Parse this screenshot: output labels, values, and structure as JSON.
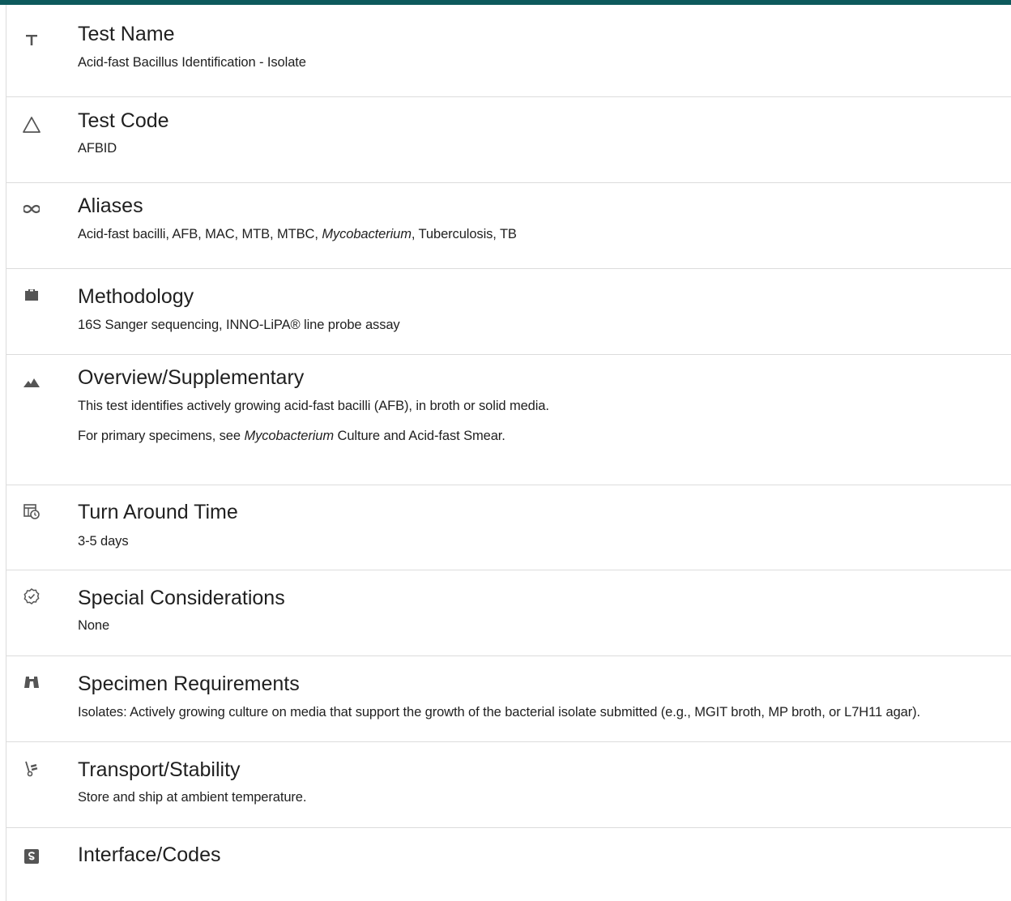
{
  "rows": [
    {
      "title": "Test Name",
      "icon": "text-t-icon",
      "lines": [
        "Acid-fast Bacillus Identification - Isolate"
      ]
    },
    {
      "title": "Test Code",
      "icon": "triangle-icon",
      "lines": [
        "AFBID"
      ]
    },
    {
      "title": "Aliases",
      "icon": "infinity-icon",
      "lines": {
        "pre": "Acid-fast bacilli, AFB, MAC, MTB, MTBC, ",
        "italic": "Mycobacterium",
        "post": ", Tuberculosis, TB"
      }
    },
    {
      "title": "Methodology",
      "icon": "briefcase-icon",
      "lines": [
        "16S Sanger sequencing, INNO-LiPA® line probe assay"
      ]
    },
    {
      "title": "Overview/Supplementary",
      "icon": "mountains-icon",
      "line1": "This test identifies actively growing acid-fast bacilli (AFB), in broth or solid media.",
      "line2": {
        "pre": "For primary specimens, see ",
        "italic": "Mycobacterium",
        "post": " Culture and Acid-fast Smear."
      }
    },
    {
      "title": "Turn Around Time",
      "icon": "calendar-clock-icon",
      "lines": [
        "3-5 days"
      ]
    },
    {
      "title": "Special Considerations",
      "icon": "badge-check-icon",
      "lines": [
        "None"
      ]
    },
    {
      "title": "Specimen Requirements",
      "icon": "binoculars-icon",
      "lines": [
        "Isolates: Actively growing culture on media that support the growth of the bacterial isolate submitted (e.g., MGIT broth, MP broth, or L7H11 agar)."
      ]
    },
    {
      "title": "Transport/Stability",
      "icon": "hand-truck-icon",
      "lines": [
        "Store and ship at ambient temperature."
      ]
    },
    {
      "title": "Interface/Codes",
      "icon": "s-square-icon",
      "lines": []
    }
  ],
  "colors": {
    "topbar": "#0d5a5c",
    "divider": "#dcdcdc",
    "text": "#1f1f1f",
    "icon": "#555555"
  }
}
